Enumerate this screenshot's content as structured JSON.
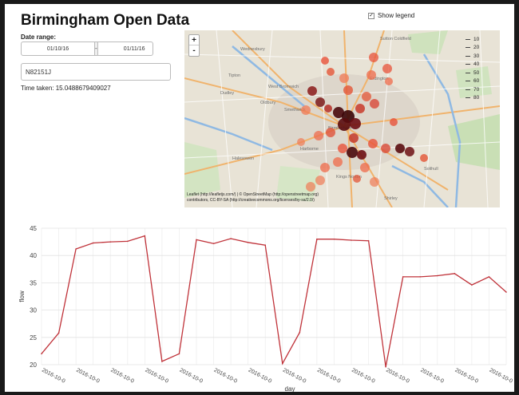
{
  "app": {
    "title": "Birmingham Open Data"
  },
  "controls": {
    "date_range_label": "Date range:",
    "date_start": "01/10/16",
    "date_separator": "-",
    "date_end": "01/11/16",
    "sensor_value": "N82151J",
    "time_taken": "Time taken: 15.0488679409027",
    "show_legend_label": "Show legend",
    "show_legend_checked": true
  },
  "map": {
    "zoom_in": "+",
    "zoom_out": "-",
    "attribution_line1": "Leaflet (http://leafletjs.com/) | © OpenStreetMap (http://openstreetmap.org)",
    "attribution_line2": "contributors, CC-BY-SA (http://creativecommons.org/licenses/by-sa/2.0/)",
    "legend": [
      "10",
      "20",
      "30",
      "40",
      "50",
      "60",
      "70",
      "80"
    ],
    "place_labels": [
      "Wednesbury",
      "Tipton",
      "Dudley",
      "West Bromwich",
      "Oldbury",
      "Smethwick",
      "Birmingham",
      "Harborne",
      "Halesowen",
      "Kings Norton",
      "Sutton Coldfield",
      "Solihull",
      "Shirley",
      "Erdington"
    ]
  },
  "chart_data": {
    "type": "line",
    "ylabel": "flow",
    "xlabel": "day",
    "ylim": [
      20,
      45
    ],
    "yticks": [
      20,
      25,
      30,
      35,
      40,
      45
    ],
    "x_tick_label": "2016-10-0",
    "color": "#c0333a",
    "values": [
      22.0,
      25.8,
      41.2,
      42.3,
      42.5,
      42.6,
      43.6,
      20.6,
      22.0,
      42.9,
      42.2,
      43.1,
      42.4,
      41.9,
      20.2,
      25.9,
      43.0,
      43.0,
      42.8,
      42.7,
      19.6,
      36.1,
      36.1,
      36.3,
      36.7,
      34.6,
      36.1,
      33.3
    ]
  }
}
